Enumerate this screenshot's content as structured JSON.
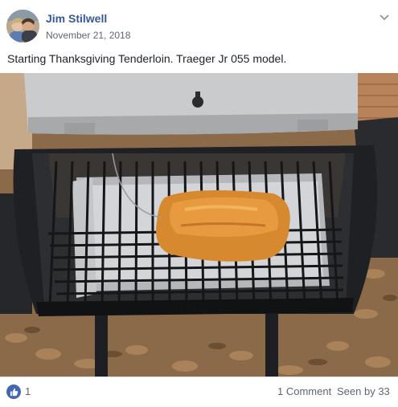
{
  "post": {
    "author": "Jim Stilwell",
    "date": "November 21, 2018",
    "caption": "Starting Thanksgiving Tenderloin. Traeger Jr 055 model.",
    "menu_icon": "chevron-down-icon",
    "photo_subject": "Tenderloin on a pellet grill"
  },
  "footer": {
    "like_icon": "thumbs-up-icon",
    "like_count": "1",
    "comments": "1 Comment",
    "seen": "Seen by 33"
  },
  "colors": {
    "author_link": "#385898",
    "like_badge": "#4267b2",
    "meta_text": "#606770"
  }
}
